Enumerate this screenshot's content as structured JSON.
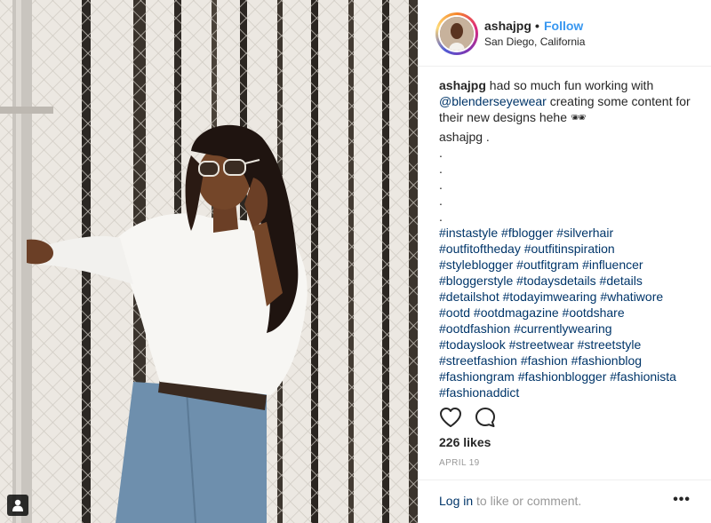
{
  "header": {
    "username": "ashajpg",
    "separator": "•",
    "follow_label": "Follow",
    "location": "San Diego, California"
  },
  "caption": {
    "username": "ashajpg",
    "text_before": "had so much fun working with",
    "mention": "@blenderseyewear",
    "text_after": "creating some content for their new designs hehe 🕶",
    "signature": "ashajpg .",
    "dots": [
      ".",
      ".",
      ".",
      ".",
      "."
    ],
    "hashtag_rows": [
      "#instastyle #fblogger #silverhair",
      "#outfitoftheday #outfitinspiration",
      "#styleblogger #outfitgram #influencer",
      "#bloggerstyle #todaysdetails #details",
      "#detailshot #todayimwearing #whatiwore",
      "#ootd #ootdmagazine #ootdshare",
      "#ootdfashion #currentlywearing",
      "#todayslook #streetwear #streetstyle",
      "#streetfashion #fashion #fashionblog",
      "#fashiongram #fashionblogger #fashionista",
      "#fashionaddict"
    ]
  },
  "actions": {
    "like_icon": "heart-icon",
    "comment_icon": "comment-icon"
  },
  "likes": "226 likes",
  "date": "APRIL 19",
  "footer": {
    "login_link": "Log in",
    "login_text": "to like or comment.",
    "more": "•••"
  },
  "colors": {
    "link": "#003569",
    "follow": "#3897f0",
    "muted": "#999999",
    "text": "#262626"
  }
}
